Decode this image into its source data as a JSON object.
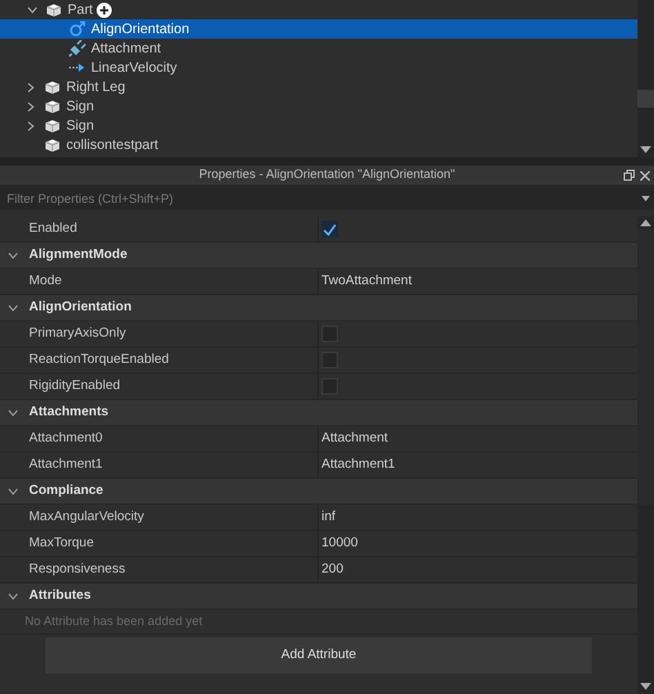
{
  "explorer": {
    "items": [
      {
        "label": "Part",
        "kind": "part",
        "expanded": true,
        "add_button": true,
        "selected": false,
        "children": [
          {
            "label": "AlignOrientation",
            "kind": "align",
            "selected": true
          },
          {
            "label": "Attachment",
            "kind": "attachment",
            "selected": false
          },
          {
            "label": "LinearVelocity",
            "kind": "velocity",
            "selected": false
          }
        ]
      },
      {
        "label": "Right Leg",
        "kind": "part",
        "expanded": false,
        "selected": false
      },
      {
        "label": "Sign",
        "kind": "part",
        "expanded": false,
        "selected": false
      },
      {
        "label": "Sign",
        "kind": "part",
        "expanded": false,
        "selected": false
      },
      {
        "label": "collisontestpart",
        "kind": "part",
        "selected": false
      }
    ]
  },
  "properties": {
    "title": "Properties - AlignOrientation \"AlignOrientation\"",
    "filter": {
      "placeholder": "Filter Properties (Ctrl+Shift+P)"
    },
    "sections": [
      {
        "rows": [
          {
            "name": "Enabled",
            "kind": "checkbox",
            "checked": true
          }
        ]
      },
      {
        "title": "AlignmentMode",
        "expanded": true,
        "rows": [
          {
            "name": "Mode",
            "kind": "text",
            "value": "TwoAttachment"
          }
        ]
      },
      {
        "title": "AlignOrientation",
        "expanded": true,
        "rows": [
          {
            "name": "PrimaryAxisOnly",
            "kind": "checkbox",
            "checked": false
          },
          {
            "name": "ReactionTorqueEnabled",
            "kind": "checkbox",
            "checked": false
          },
          {
            "name": "RigidityEnabled",
            "kind": "checkbox",
            "checked": false
          }
        ]
      },
      {
        "title": "Attachments",
        "expanded": true,
        "rows": [
          {
            "name": "Attachment0",
            "kind": "text",
            "value": "Attachment"
          },
          {
            "name": "Attachment1",
            "kind": "text",
            "value": "Attachment1"
          }
        ]
      },
      {
        "title": "Compliance",
        "expanded": true,
        "rows": [
          {
            "name": "MaxAngularVelocity",
            "kind": "text",
            "value": "inf"
          },
          {
            "name": "MaxTorque",
            "kind": "text",
            "value": "10000"
          },
          {
            "name": "Responsiveness",
            "kind": "text",
            "value": "200"
          }
        ]
      },
      {
        "title": "Attributes",
        "expanded": true
      }
    ],
    "attributes": {
      "empty_message": "No Attribute has been added yet",
      "add_button": "Add Attribute"
    }
  }
}
